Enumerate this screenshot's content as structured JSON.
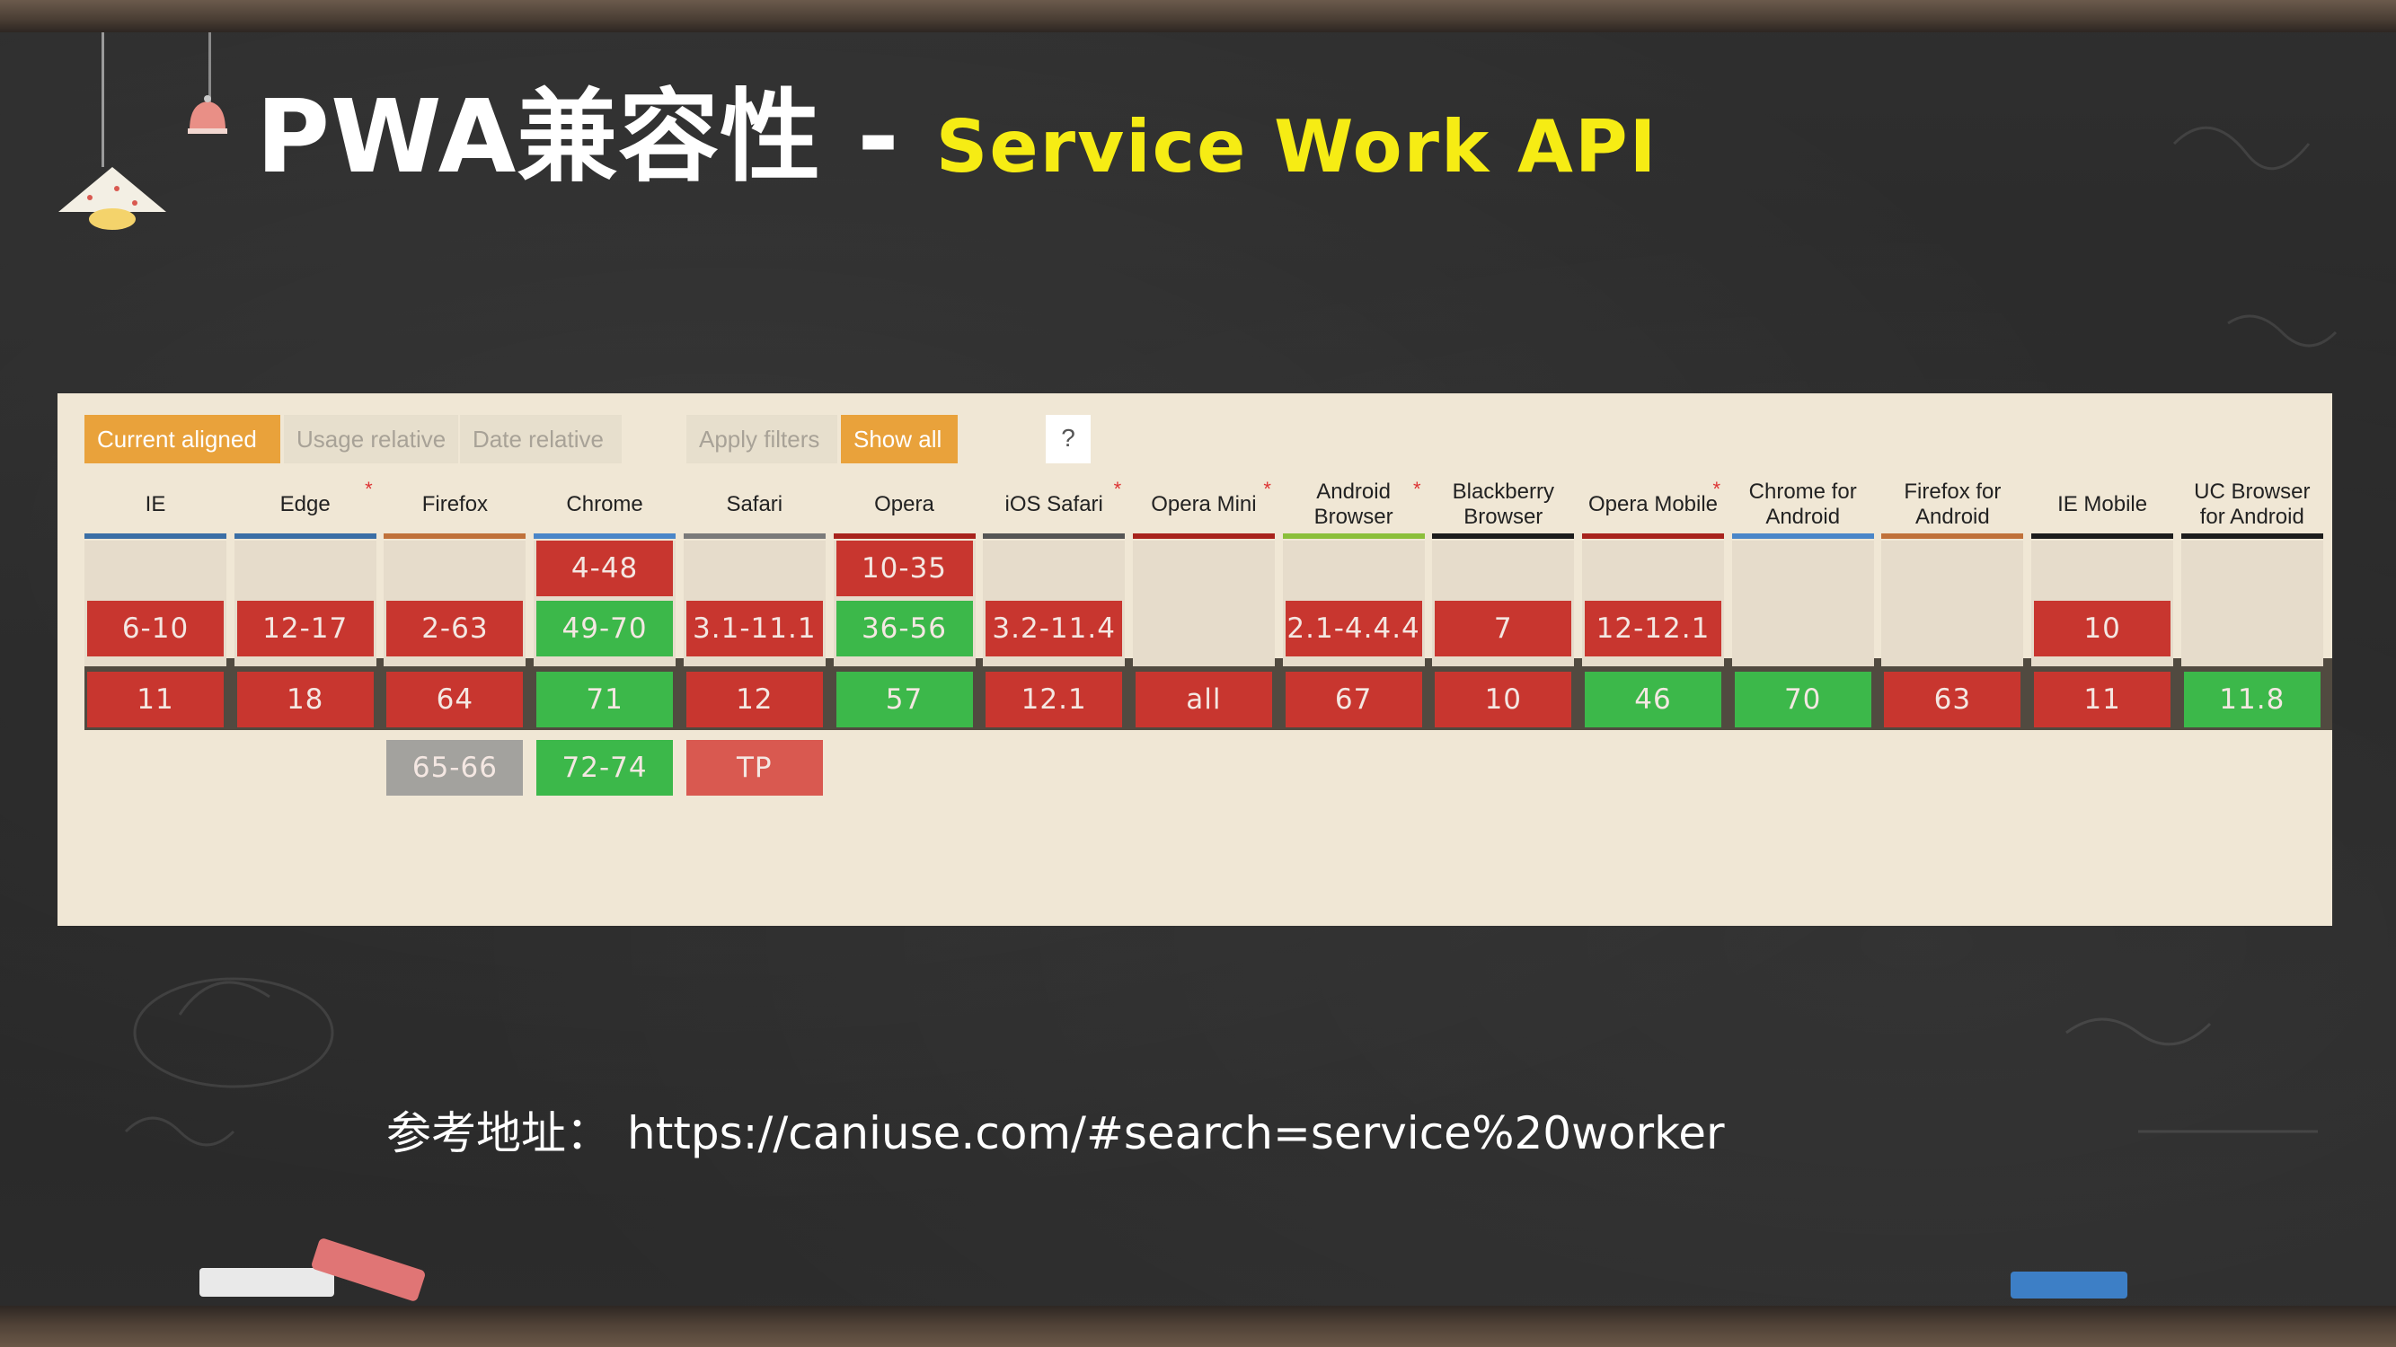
{
  "slide": {
    "title_main": "PWA兼容性 -",
    "title_sub": "Service Work API"
  },
  "toolbar": {
    "current_aligned": "Current aligned",
    "usage_relative": "Usage relative",
    "date_relative": "Date relative",
    "apply_filters": "Apply filters",
    "show_all": "Show all",
    "help": "?"
  },
  "browsers": [
    {
      "name": "IE",
      "star": "",
      "bar_color": "#3a6ea5",
      "rows": [
        "",
        "6-10",
        "11",
        ""
      ],
      "colors": [
        "",
        "red",
        "red",
        ""
      ]
    },
    {
      "name": "Edge",
      "star": "*",
      "bar_color": "#3a6ea5",
      "rows": [
        "",
        "12-17",
        "18",
        ""
      ],
      "colors": [
        "",
        "red",
        "red",
        ""
      ]
    },
    {
      "name": "Firefox",
      "star": "",
      "bar_color": "#c0713a",
      "rows": [
        "",
        "2-63",
        "64",
        "65-66"
      ],
      "colors": [
        "",
        "red",
        "red",
        "gray"
      ]
    },
    {
      "name": "Chrome",
      "star": "",
      "bar_color": "#4a86c8",
      "rows": [
        "4-48",
        "49-70",
        "71",
        "72-74"
      ],
      "colors": [
        "red",
        "green",
        "green",
        "green"
      ]
    },
    {
      "name": "Safari",
      "star": "",
      "bar_color": "#7a7a7a",
      "rows": [
        "",
        "3.1-11.1",
        "12",
        "TP"
      ],
      "colors": [
        "",
        "red",
        "red",
        "pink"
      ]
    },
    {
      "name": "Opera",
      "star": "",
      "bar_color": "#a8231c",
      "rows": [
        "10-35",
        "36-56",
        "57",
        ""
      ],
      "colors": [
        "red",
        "green",
        "green",
        ""
      ]
    },
    {
      "name": "iOS Safari",
      "star": "*",
      "bar_color": "#555555",
      "rows": [
        "",
        "3.2-11.4",
        "12.1",
        ""
      ],
      "colors": [
        "",
        "red",
        "red",
        ""
      ]
    },
    {
      "name": "Opera Mini",
      "star": "*",
      "bar_color": "#a8231c",
      "rows": [
        "",
        "",
        "all",
        ""
      ],
      "colors": [
        "",
        "",
        "red",
        ""
      ]
    },
    {
      "name": "Android Browser",
      "star": "*",
      "bar_color": "#8bbf3a",
      "rows": [
        "",
        "2.1-4.4.4",
        "67",
        ""
      ],
      "colors": [
        "",
        "red",
        "red",
        ""
      ]
    },
    {
      "name": "Blackberry Browser",
      "star": "",
      "bar_color": "#1c1c1c",
      "rows": [
        "",
        "7",
        "10",
        ""
      ],
      "colors": [
        "",
        "red",
        "red",
        ""
      ]
    },
    {
      "name": "Opera Mobile",
      "star": "*",
      "bar_color": "#a8231c",
      "rows": [
        "",
        "12-12.1",
        "46",
        ""
      ],
      "colors": [
        "",
        "red",
        "green",
        ""
      ]
    },
    {
      "name": "Chrome for Android",
      "star": "",
      "bar_color": "#4a86c8",
      "rows": [
        "",
        "",
        "70",
        ""
      ],
      "colors": [
        "",
        "",
        "green",
        ""
      ]
    },
    {
      "name": "Firefox for Android",
      "star": "",
      "bar_color": "#c0713a",
      "rows": [
        "",
        "",
        "63",
        ""
      ],
      "colors": [
        "",
        "",
        "red",
        ""
      ]
    },
    {
      "name": "IE Mobile",
      "star": "",
      "bar_color": "#1c1c1c",
      "rows": [
        "",
        "10",
        "11",
        ""
      ],
      "colors": [
        "",
        "red",
        "red",
        ""
      ]
    },
    {
      "name": "UC Browser for Android",
      "star": "",
      "bar_color": "#1c1c1c",
      "rows": [
        "",
        "",
        "11.8",
        ""
      ],
      "colors": [
        "",
        "",
        "green",
        ""
      ]
    }
  ],
  "reference": {
    "label": "参考地址：",
    "url": "https://caniuse.com/#search=service%20worker"
  }
}
